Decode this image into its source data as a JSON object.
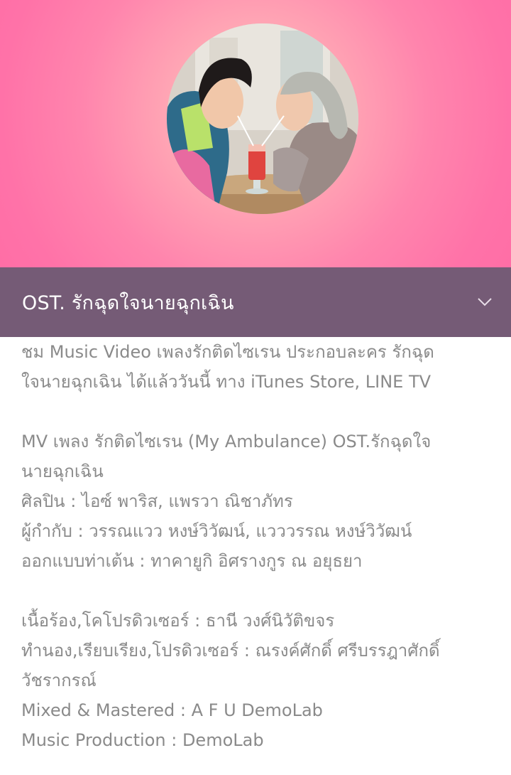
{
  "header": {
    "avatar_icon": "mv-thumbnail-circle",
    "title": "OST. รักฉุดใจนายฉุกเฉิน",
    "expand_icon": "chevron-down-icon"
  },
  "description": {
    "lines": [
      "ชม Music Video เพลงรักติดไซเรน ประกอบละคร รักฉุด",
      "ใจนายฉุกเฉิน ได้แล้ววันนี้ ทาง iTunes Store, LINE TV",
      "",
      "MV เพลง รักติดไซเรน (My Ambulance) OST.รักฉุดใจ",
      "นายฉุกเฉิน",
      "ศิลปิน : ไอซ์ พาริส, แพรวา ณิชาภัทร",
      "ผู้กำกับ : วรรณแวว หงษ์วิวัฒน์, แวววรรณ หงษ์วิวัฒน์",
      "ออกแบบท่าเต้น : ทาคายูกิ อิศรางกูร ณ อยุธยา",
      "",
      "เนื้อร้อง,โคโปรดิวเซอร์ : ธานี วงศ์นิวัติขจร",
      "ทำนอง,เรียบเรียง,โปรดิวเซอร์ : ณรงค์ศักดิ์ ศรีบรรฎาศักดิ์",
      "วัชรากรณ์",
      "Mixed & Mastered : A F U  DemoLab",
      "Music Production : DemoLab"
    ]
  },
  "colors": {
    "hero_pink": "#ff7fad",
    "title_bar": "#755b76",
    "text_gray": "#8a8a8a"
  }
}
